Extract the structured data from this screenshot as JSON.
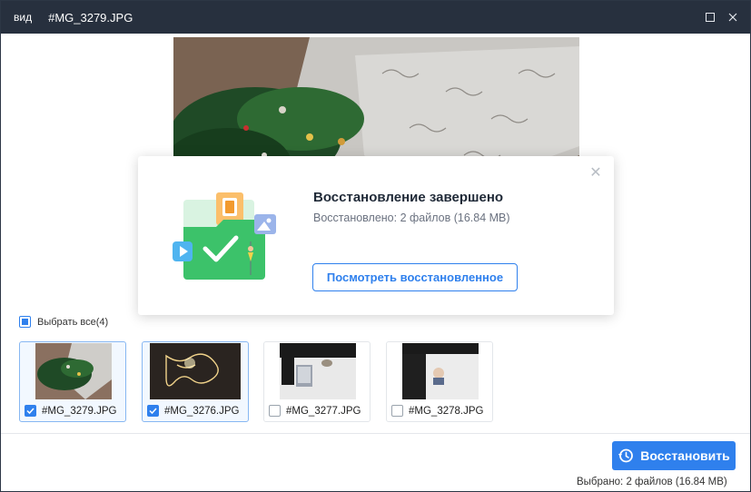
{
  "titlebar": {
    "menu_label": "вид",
    "title": "#MG_3279.JPG",
    "maximize_icon": "maximize-icon",
    "close_icon": "close-icon"
  },
  "modal": {
    "heading": "Восстановление завершено",
    "subtext": "Восстановлено: 2 файлов (16.84 MB)",
    "view_button_label": "Посмотреть восстановленное",
    "close_icon": "close-icon",
    "accent_color": "#2f80ed",
    "folder_color": "#3cc26a"
  },
  "select_all": {
    "label": "Выбрать все(4)",
    "state": "partial"
  },
  "files": [
    {
      "name": "#MG_3279.JPG",
      "checked": true
    },
    {
      "name": "#MG_3276.JPG",
      "checked": true
    },
    {
      "name": "#MG_3277.JPG",
      "checked": false
    },
    {
      "name": "#MG_3278.JPG",
      "checked": false
    }
  ],
  "footer": {
    "restore_button_label": "Восстановить",
    "status_text": "Выбрано: 2 файлов  (16.84 MB)",
    "button_color": "#2f80ed"
  }
}
